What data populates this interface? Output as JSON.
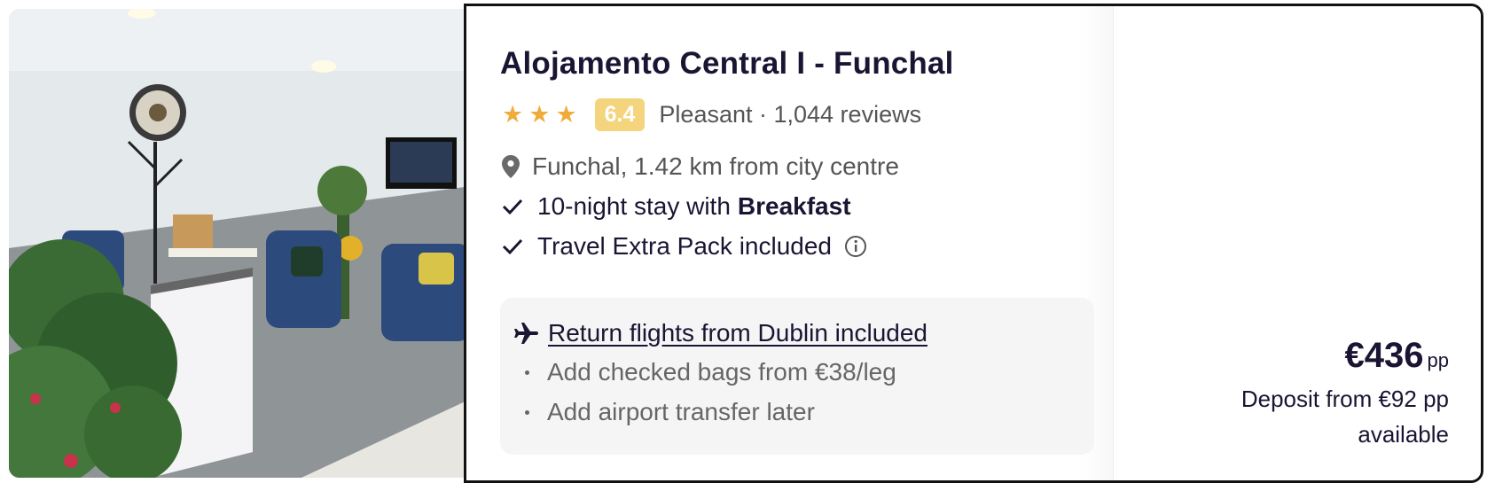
{
  "hotel": {
    "name": "Alojamento Central I - Funchal",
    "star_rating": 3,
    "score": "6.4",
    "rating_text": "Pleasant · 1,044 reviews",
    "location": "Funchal, 1.42 km from city centre"
  },
  "features": {
    "stay_prefix": "10-night stay with",
    "stay_board": "Breakfast",
    "extra_pack": "Travel Extra Pack included"
  },
  "flights": {
    "link": "Return flights from Dublin included",
    "bags": "Add checked bags from €38/leg",
    "transfer": "Add airport transfer later"
  },
  "price": {
    "amount": "€436",
    "unit": "pp",
    "deposit_line1": "Deposit from €92 pp",
    "deposit_line2": "available"
  },
  "icons": {
    "star": "star-icon",
    "location": "map-pin-icon",
    "check": "check-icon",
    "info": "info-icon",
    "plane": "plane-icon"
  },
  "colors": {
    "star": "#efac3a",
    "score_bg": "#f4d47c",
    "title": "#1b1433",
    "box_bg": "#f5f5f5"
  }
}
